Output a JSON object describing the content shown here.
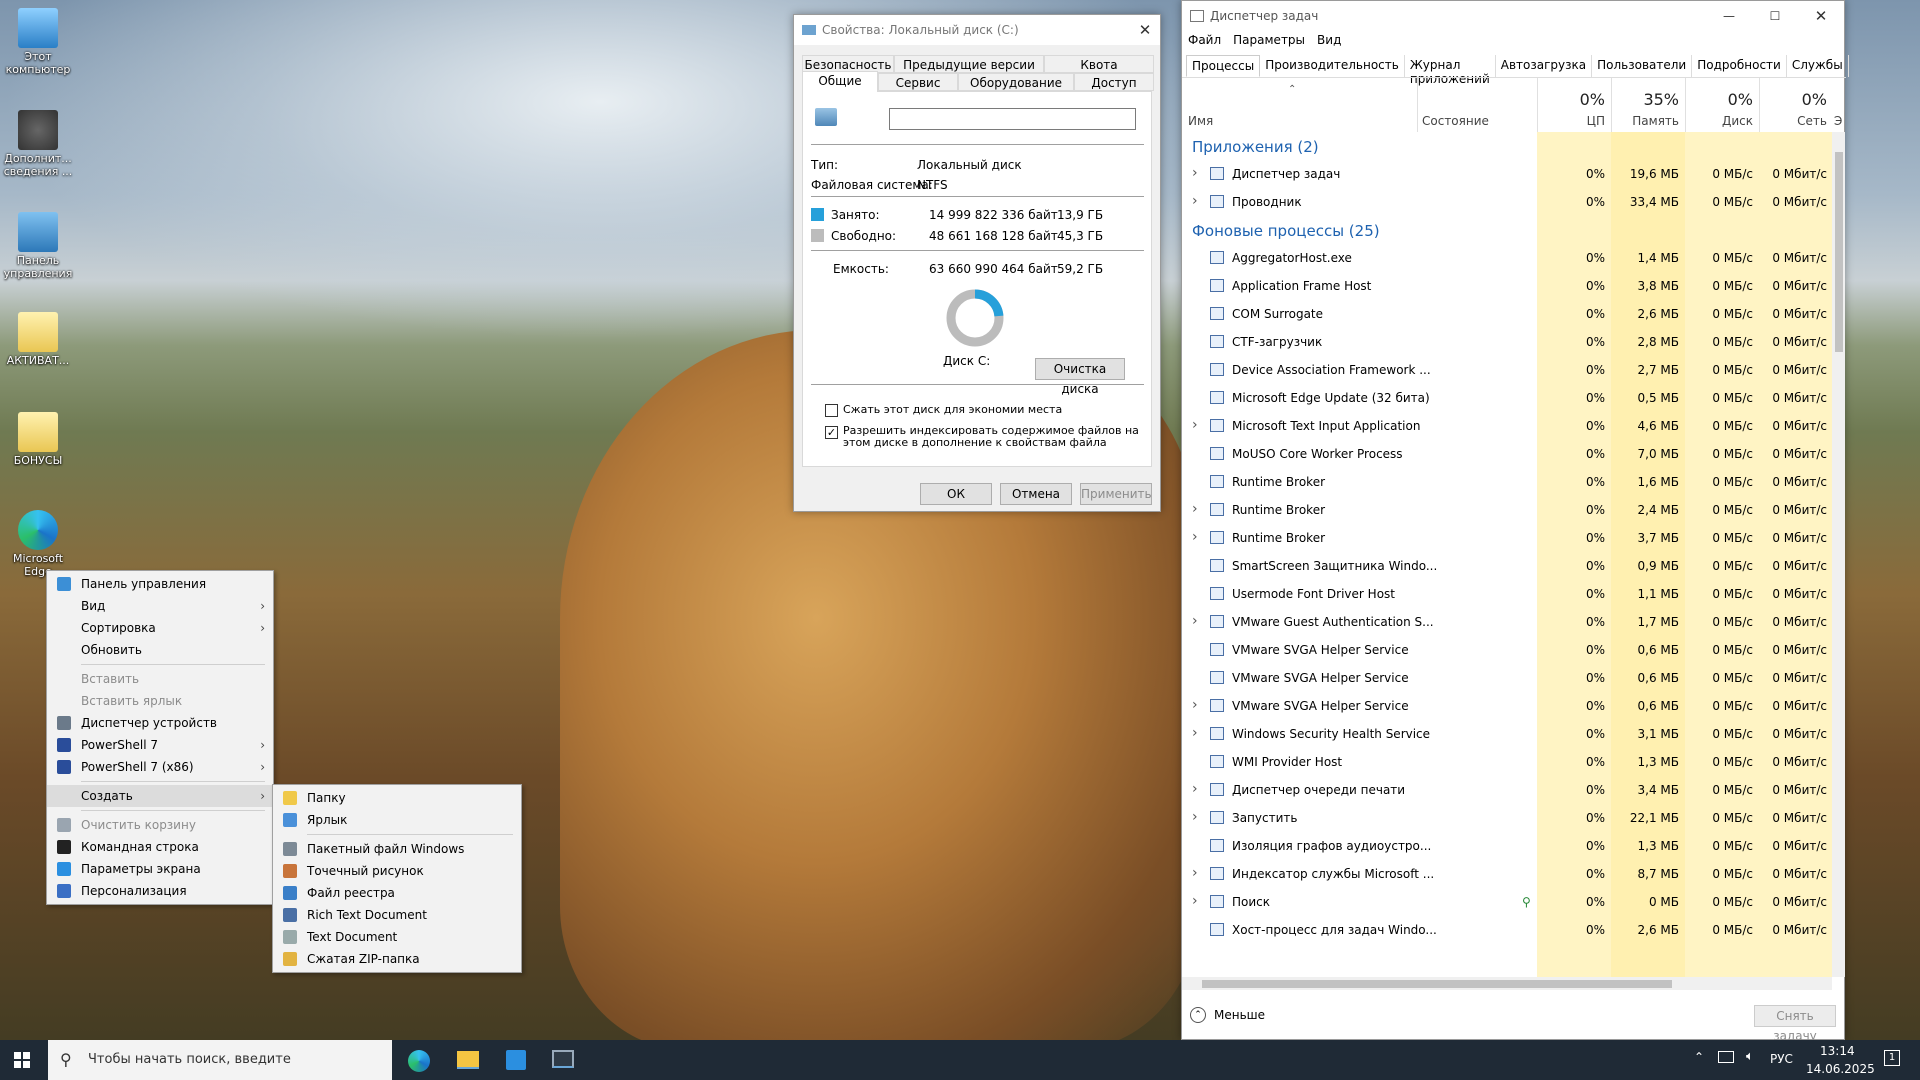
{
  "desktop": {
    "icons": [
      {
        "label": "Этот компьютер",
        "icon": "computer-icon"
      },
      {
        "label": "Дополнит... сведения ...",
        "icon": "info-icon"
      },
      {
        "label": "Панель управления",
        "icon": "control-panel-icon"
      },
      {
        "label": "АКТИВАТ...",
        "icon": "folder-icon"
      },
      {
        "label": "БОНУСЫ",
        "icon": "folder-icon"
      },
      {
        "label": "Microsoft Edge",
        "icon": "edge-icon"
      }
    ]
  },
  "context_menu": {
    "items": [
      {
        "label": "Панель управления",
        "icon": "control-panel-icon",
        "disabled": false,
        "submenu": false
      },
      {
        "label": "Вид",
        "disabled": false,
        "submenu": true
      },
      {
        "label": "Сортировка",
        "disabled": false,
        "submenu": true
      },
      {
        "label": "Обновить",
        "disabled": false,
        "submenu": false
      },
      {
        "sep": true
      },
      {
        "label": "Вставить",
        "disabled": true,
        "submenu": false
      },
      {
        "label": "Вставить ярлык",
        "disabled": true,
        "submenu": false
      },
      {
        "label": "Диспетчер устройств",
        "icon": "device-manager-icon",
        "disabled": false,
        "submenu": false
      },
      {
        "label": "PowerShell 7",
        "icon": "powershell-icon",
        "disabled": false,
        "submenu": true
      },
      {
        "label": "PowerShell 7 (x86)",
        "icon": "powershell-icon",
        "disabled": false,
        "submenu": true
      },
      {
        "sep": true
      },
      {
        "label": "Создать",
        "disabled": false,
        "submenu": true,
        "highlight": true
      },
      {
        "sep": true
      },
      {
        "label": "Очистить корзину",
        "icon": "recycle-bin-icon",
        "disabled": true,
        "submenu": false
      },
      {
        "label": "Командная строка",
        "icon": "cmd-icon",
        "disabled": false,
        "submenu": false
      },
      {
        "label": "Параметры экрана",
        "icon": "display-icon",
        "disabled": false,
        "submenu": false
      },
      {
        "label": "Персонализация",
        "icon": "personalize-icon",
        "disabled": false,
        "submenu": false
      }
    ],
    "create_submenu": [
      {
        "label": "Папку",
        "icon": "folder-icon"
      },
      {
        "label": "Ярлык",
        "icon": "shortcut-icon"
      },
      {
        "sep": true
      },
      {
        "label": "Пакетный файл Windows",
        "icon": "batch-file-icon"
      },
      {
        "label": "Точечный рисунок",
        "icon": "bitmap-icon"
      },
      {
        "label": "Файл реестра",
        "icon": "registry-icon"
      },
      {
        "label": "Rich Text Document",
        "icon": "rtf-icon"
      },
      {
        "label": "Text Document",
        "icon": "text-doc-icon"
      },
      {
        "label": "Сжатая ZIP-папка",
        "icon": "zip-icon"
      }
    ]
  },
  "properties": {
    "title": "Свойства: Локальный диск (C:)",
    "tabs_top": [
      "Безопасность",
      "Предыдущие версии",
      "Квота"
    ],
    "tabs_bottom": [
      "Общие",
      "Сервис",
      "Оборудование",
      "Доступ"
    ],
    "name_value": "",
    "type_label": "Тип:",
    "type_value": "Локальный диск",
    "fs_label": "Файловая система:",
    "fs_value": "NTFS",
    "used_label": "Занято:",
    "used_bytes": "14 999 822 336 байт",
    "used_gb": "13,9 ГБ",
    "free_label": "Свободно:",
    "free_bytes": "48 661 168 128 байт",
    "free_gb": "45,3 ГБ",
    "cap_label": "Емкость:",
    "cap_bytes": "63 660 990 464 байт",
    "cap_gb": "59,2 ГБ",
    "disk_label": "Диск C:",
    "cleanup_button": "Очистка диска",
    "compress_label": "Сжать этот диск для экономии места",
    "index_label": "Разрешить индексировать содержимое файлов на этом диске в дополнение к свойствам файла",
    "ok": "ОК",
    "cancel": "Отмена",
    "apply": "Применить",
    "used_fraction": 0.236,
    "used_color": "#26a0da",
    "free_color": "#bcbcbc"
  },
  "taskmgr": {
    "title": "Диспетчер задач",
    "menu": [
      "Файл",
      "Параметры",
      "Вид"
    ],
    "tabs": [
      "Процессы",
      "Производительность",
      "Журнал приложений",
      "Автозагрузка",
      "Пользователи",
      "Подробности",
      "Службы"
    ],
    "columns": {
      "name": "Имя",
      "status": "Состояние",
      "cpu_pct": "0%",
      "cpu": "ЦП",
      "mem_pct": "35%",
      "mem": "Память",
      "disk_pct": "0%",
      "disk": "Диск",
      "net_pct": "0%",
      "net": "Сеть",
      "extra": "Э"
    },
    "groups": [
      {
        "title": "Приложения (2)",
        "rows": [
          {
            "name": "Диспетчер задач",
            "expand": true,
            "cpu": "0%",
            "mem": "19,6 МБ",
            "disk": "0 МБ/с",
            "net": "0 Мбит/с"
          },
          {
            "name": "Проводник",
            "expand": true,
            "cpu": "0%",
            "mem": "33,4 МБ",
            "disk": "0 МБ/с",
            "net": "0 Мбит/с"
          }
        ]
      },
      {
        "title": "Фоновые процессы (25)",
        "rows": [
          {
            "name": "AggregatorHost.exe",
            "expand": false,
            "cpu": "0%",
            "mem": "1,4 МБ",
            "disk": "0 МБ/с",
            "net": "0 Мбит/с"
          },
          {
            "name": "Application Frame Host",
            "expand": false,
            "cpu": "0%",
            "mem": "3,8 МБ",
            "disk": "0 МБ/с",
            "net": "0 Мбит/с"
          },
          {
            "name": "COM Surrogate",
            "expand": false,
            "cpu": "0%",
            "mem": "2,6 МБ",
            "disk": "0 МБ/с",
            "net": "0 Мбит/с"
          },
          {
            "name": "CTF-загрузчик",
            "expand": false,
            "cpu": "0%",
            "mem": "2,8 МБ",
            "disk": "0 МБ/с",
            "net": "0 Мбит/с"
          },
          {
            "name": "Device Association Framework ...",
            "expand": false,
            "cpu": "0%",
            "mem": "2,7 МБ",
            "disk": "0 МБ/с",
            "net": "0 Мбит/с"
          },
          {
            "name": "Microsoft Edge Update (32 бита)",
            "expand": false,
            "cpu": "0%",
            "mem": "0,5 МБ",
            "disk": "0 МБ/с",
            "net": "0 Мбит/с"
          },
          {
            "name": "Microsoft Text Input Application",
            "expand": true,
            "cpu": "0%",
            "mem": "4,6 МБ",
            "disk": "0 МБ/с",
            "net": "0 Мбит/с"
          },
          {
            "name": "MoUSO Core Worker Process",
            "expand": false,
            "cpu": "0%",
            "mem": "7,0 МБ",
            "disk": "0 МБ/с",
            "net": "0 Мбит/с"
          },
          {
            "name": "Runtime Broker",
            "expand": false,
            "cpu": "0%",
            "mem": "1,6 МБ",
            "disk": "0 МБ/с",
            "net": "0 Мбит/с"
          },
          {
            "name": "Runtime Broker",
            "expand": true,
            "cpu": "0%",
            "mem": "2,4 МБ",
            "disk": "0 МБ/с",
            "net": "0 Мбит/с"
          },
          {
            "name": "Runtime Broker",
            "expand": true,
            "cpu": "0%",
            "mem": "3,7 МБ",
            "disk": "0 МБ/с",
            "net": "0 Мбит/с"
          },
          {
            "name": "SmartScreen Защитника Windo...",
            "expand": false,
            "cpu": "0%",
            "mem": "0,9 МБ",
            "disk": "0 МБ/с",
            "net": "0 Мбит/с"
          },
          {
            "name": "Usermode Font Driver Host",
            "expand": false,
            "cpu": "0%",
            "mem": "1,1 МБ",
            "disk": "0 МБ/с",
            "net": "0 Мбит/с"
          },
          {
            "name": "VMware Guest Authentication S...",
            "expand": true,
            "cpu": "0%",
            "mem": "1,7 МБ",
            "disk": "0 МБ/с",
            "net": "0 Мбит/с"
          },
          {
            "name": "VMware SVGA Helper Service",
            "expand": false,
            "cpu": "0%",
            "mem": "0,6 МБ",
            "disk": "0 МБ/с",
            "net": "0 Мбит/с"
          },
          {
            "name": "VMware SVGA Helper Service",
            "expand": false,
            "cpu": "0%",
            "mem": "0,6 МБ",
            "disk": "0 МБ/с",
            "net": "0 Мбит/с"
          },
          {
            "name": "VMware SVGA Helper Service",
            "expand": true,
            "cpu": "0%",
            "mem": "0,6 МБ",
            "disk": "0 МБ/с",
            "net": "0 Мбит/с"
          },
          {
            "name": "Windows Security Health Service",
            "expand": true,
            "cpu": "0%",
            "mem": "3,1 МБ",
            "disk": "0 МБ/с",
            "net": "0 Мбит/с"
          },
          {
            "name": "WMI Provider Host",
            "expand": false,
            "cpu": "0%",
            "mem": "1,3 МБ",
            "disk": "0 МБ/с",
            "net": "0 Мбит/с"
          },
          {
            "name": "Диспетчер очереди печати",
            "expand": true,
            "cpu": "0%",
            "mem": "3,4 МБ",
            "disk": "0 МБ/с",
            "net": "0 Мбит/с"
          },
          {
            "name": "Запустить",
            "expand": true,
            "cpu": "0%",
            "mem": "22,1 МБ",
            "disk": "0 МБ/с",
            "net": "0 Мбит/с"
          },
          {
            "name": "Изоляция графов аудиоустро...",
            "expand": false,
            "cpu": "0%",
            "mem": "1,3 МБ",
            "disk": "0 МБ/с",
            "net": "0 Мбит/с"
          },
          {
            "name": "Индексатор службы Microsoft ...",
            "expand": true,
            "cpu": "0%",
            "mem": "8,7 МБ",
            "disk": "0 МБ/с",
            "net": "0 Мбит/с"
          },
          {
            "name": "Поиск",
            "expand": true,
            "pin": true,
            "cpu": "0%",
            "mem": "0 МБ",
            "disk": "0 МБ/с",
            "net": "0 Мбит/с"
          },
          {
            "name": "Хост-процесс для задач Windo...",
            "expand": false,
            "cpu": "0%",
            "mem": "2,6 МБ",
            "disk": "0 МБ/с",
            "net": "0 Мбит/с"
          }
        ]
      }
    ],
    "less_label": "Меньше",
    "end_task": "Снять задачу"
  },
  "taskbar": {
    "search_placeholder": "Чтобы начать поиск, введите",
    "lang": "РУС",
    "time": "13:14",
    "date": "14.06.2025",
    "notif_count": "1"
  }
}
